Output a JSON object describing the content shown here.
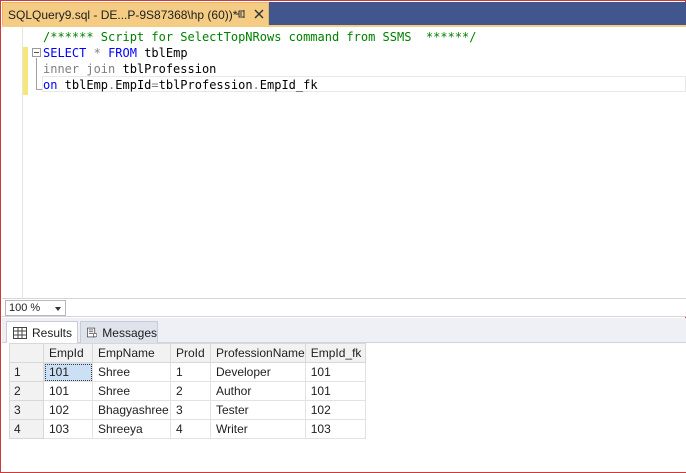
{
  "document_tab": {
    "title": "SQLQuery9.sql - DE...P-9S87368\\hp (60))*"
  },
  "editor": {
    "lines": [
      [
        {
          "text": "/****** Script for SelectTopNRows command from SSMS  ******/",
          "cls": "k-green"
        }
      ],
      [
        {
          "text": "SELECT",
          "cls": "k-blue"
        },
        {
          "text": " ",
          "cls": "k-text"
        },
        {
          "text": "*",
          "cls": "k-gray"
        },
        {
          "text": " ",
          "cls": "k-text"
        },
        {
          "text": "FROM",
          "cls": "k-blue"
        },
        {
          "text": " tblEmp",
          "cls": "k-text"
        }
      ],
      [
        {
          "text": "inner join",
          "cls": "k-gray"
        },
        {
          "text": " tblProfession",
          "cls": "k-text"
        }
      ],
      [
        {
          "text": "on",
          "cls": "k-blue"
        },
        {
          "text": " tblEmp",
          "cls": "k-text"
        },
        {
          "text": ".",
          "cls": "k-gray"
        },
        {
          "text": "EmpId",
          "cls": "k-text"
        },
        {
          "text": "=",
          "cls": "k-gray"
        },
        {
          "text": "tblProfession",
          "cls": "k-text"
        },
        {
          "text": ".",
          "cls": "k-gray"
        },
        {
          "text": "EmpId_fk",
          "cls": "k-text"
        }
      ]
    ]
  },
  "zoom": {
    "value": "100 %"
  },
  "result_tabs": {
    "results_label": "Results",
    "messages_label": "Messages"
  },
  "grid": {
    "columns": [
      "EmpId",
      "EmpName",
      "ProId",
      "ProfessionName",
      "EmpId_fk"
    ],
    "rows": [
      {
        "num": "1",
        "cells": [
          "101",
          "Shree",
          "1",
          "Developer",
          "101"
        ]
      },
      {
        "num": "2",
        "cells": [
          "101",
          "Shree",
          "2",
          "Author",
          "101"
        ]
      },
      {
        "num": "3",
        "cells": [
          "102",
          "Bhagyashree",
          "3",
          "Tester",
          "102"
        ]
      },
      {
        "num": "4",
        "cells": [
          "103",
          "Shreeya",
          "4",
          "Writer",
          "103"
        ]
      }
    ]
  },
  "icons": {
    "pin": "pin-icon",
    "close": "close-icon",
    "results": "grid-icon",
    "messages": "messages-icon",
    "dropdown": "chevron-down-icon"
  },
  "colors": {
    "tab_active": "#f5cc84",
    "tab_strip": "#40568d",
    "keyword": "#0000ff",
    "comment": "#008000",
    "operator": "#808080",
    "selected_cell": "#cce0f5"
  }
}
